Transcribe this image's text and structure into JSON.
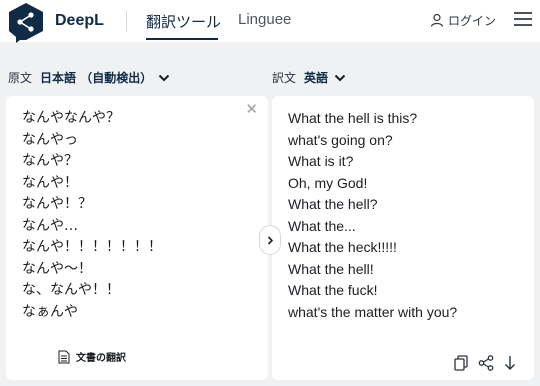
{
  "header": {
    "brand": "DeepL",
    "tabs": [
      {
        "label": "翻訳ツール",
        "active": true
      },
      {
        "label": "Linguee",
        "active": false
      }
    ],
    "login_label": "ログイン"
  },
  "source": {
    "label": "原文",
    "language": "日本語 （自動検出）",
    "lines": [
      "なんやなんや？",
      "なんやっ",
      "なんや？",
      "なんや！",
      "なんや！？",
      "なんや…",
      "なんや！！！！！！！",
      "なんや～！",
      "な、なんや！！",
      "なぁんや"
    ],
    "document_translation_label": "文書の翻訳"
  },
  "target": {
    "label": "訳文",
    "language": "英語",
    "lines": [
      "What the hell is this?",
      "what's going on?",
      "What is it?",
      "Oh, my God!",
      "What the hell?",
      "What the...",
      "What the heck!!!!!",
      "What the hell!",
      "What the fuck!",
      "what's the matter with you?"
    ]
  },
  "colors": {
    "brand_navy": "#0f2b46",
    "background": "#f0f1f3",
    "panel": "#ffffff"
  }
}
